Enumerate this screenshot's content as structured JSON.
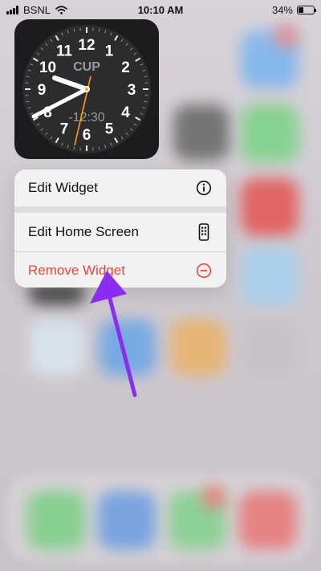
{
  "status_bar": {
    "carrier": "BSNL",
    "time": "10:10 AM",
    "battery": "34%",
    "icons": [
      "signal-icon",
      "wifi-icon",
      "battery-icon"
    ]
  },
  "clock_widget": {
    "city": "CUP",
    "offset": "-12:30",
    "numbers": [
      "12",
      "1",
      "2",
      "3",
      "4",
      "5",
      "6",
      "7",
      "8",
      "9",
      "10",
      "11"
    ],
    "colors": {
      "face": "#1c1c1e",
      "hands": "#ffffff",
      "second_hand": "#ff9f0a"
    }
  },
  "context_menu": {
    "items": [
      {
        "label": "Edit Widget",
        "icon": "info-icon"
      },
      {
        "label": "Edit Home Screen",
        "icon": "phone-icon"
      },
      {
        "label": "Remove Widget",
        "icon": "minus-circle-icon"
      }
    ],
    "colors": {
      "danger": "#e5483f"
    }
  },
  "annotation": {
    "icon": "pointer-arrow-icon",
    "color": "#8b2df0"
  }
}
